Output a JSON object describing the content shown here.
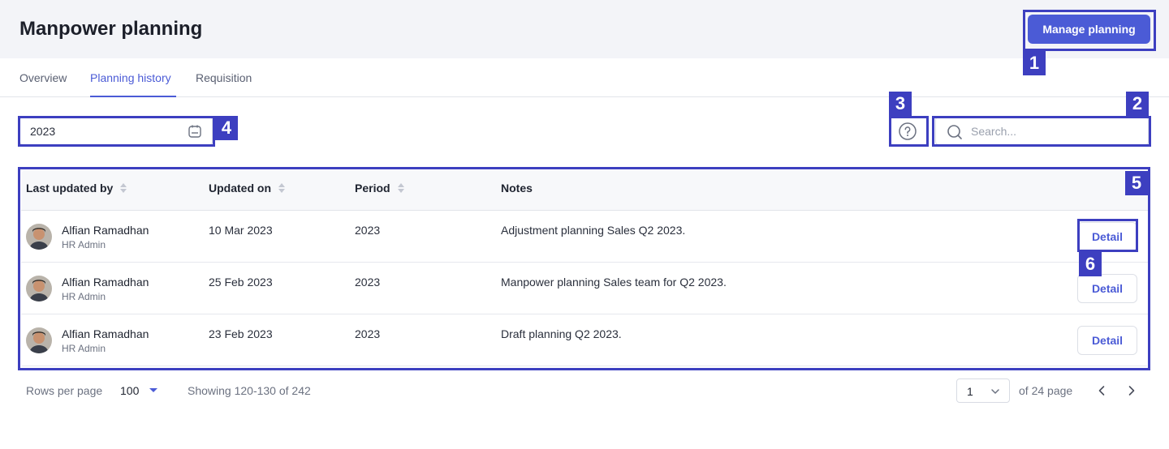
{
  "header": {
    "title": "Manpower planning",
    "primary_button": "Manage planning"
  },
  "tabs": [
    {
      "label": "Overview",
      "active": false
    },
    {
      "label": "Planning history",
      "active": true
    },
    {
      "label": "Requisition",
      "active": false
    }
  ],
  "filters": {
    "year_value": "2023",
    "search_placeholder": "Search..."
  },
  "table": {
    "columns": [
      "Last updated by",
      "Updated on",
      "Period",
      "Notes"
    ],
    "rows": [
      {
        "name": "Alfian Ramadhan",
        "role": "HR Admin",
        "updated_on": "10 Mar 2023",
        "period": "2023",
        "notes": "Adjustment planning Sales Q2 2023.",
        "action": "Detail"
      },
      {
        "name": "Alfian Ramadhan",
        "role": "HR Admin",
        "updated_on": "25 Feb 2023",
        "period": "2023",
        "notes": "Manpower planning Sales team for Q2 2023.",
        "action": "Detail"
      },
      {
        "name": "Alfian Ramadhan",
        "role": "HR Admin",
        "updated_on": "23 Feb 2023",
        "period": "2023",
        "notes": "Draft planning Q2 2023.",
        "action": "Detail"
      }
    ]
  },
  "pagination": {
    "rows_per_page_label": "Rows per page",
    "rows_per_page_value": "100",
    "showing_text": "Showing 120-130 of 242",
    "current_page": "1",
    "of_pages_text": "of 24 page"
  },
  "annotations": [
    "1",
    "2",
    "3",
    "4",
    "5",
    "6"
  ],
  "colors": {
    "accent": "#4b5bd6",
    "annotation": "#3d3fc0",
    "header_bg": "#f3f4f8"
  }
}
